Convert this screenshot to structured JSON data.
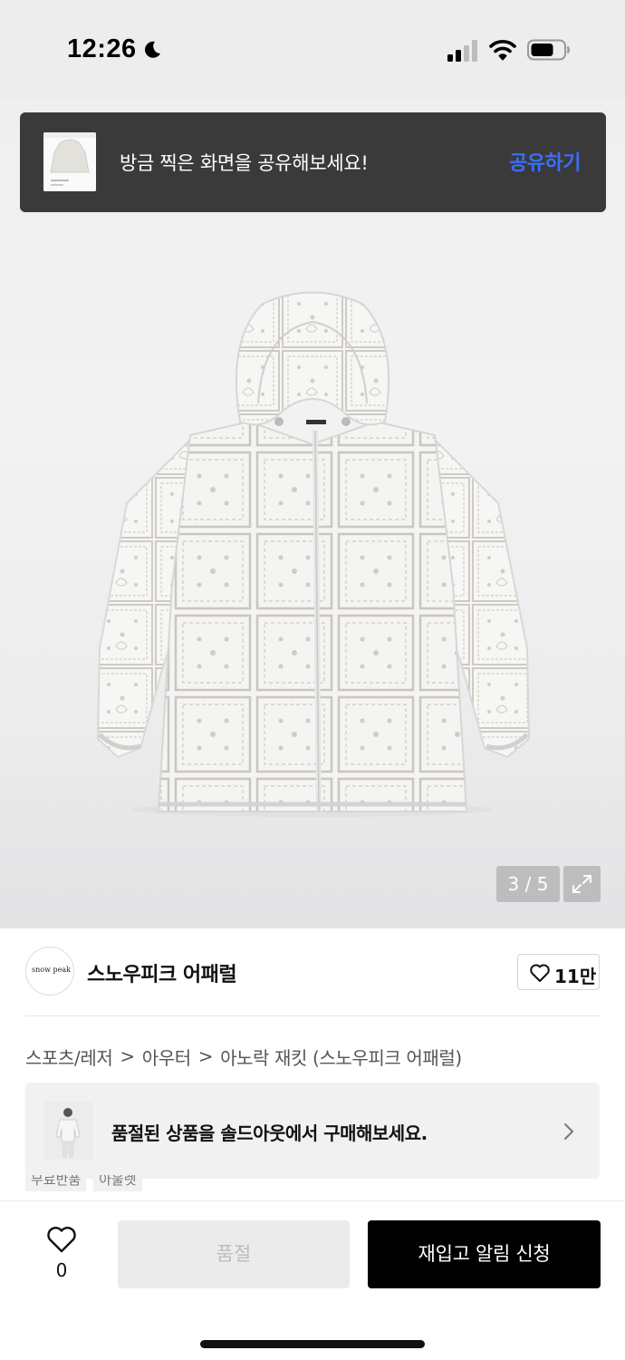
{
  "status_bar": {
    "time": "12:26",
    "icons": [
      "moon-icon",
      "cellular-signal-icon",
      "wifi-icon",
      "battery-icon"
    ]
  },
  "share_toast": {
    "message": "방금 찍은 화면을 공유해보세요!",
    "action_label": "공유하기",
    "action_color": "#3c6ef5"
  },
  "gallery": {
    "current_page": 3,
    "total_pages": 5,
    "page_indicator": "3 / 5",
    "expand_icon": "expand-icon"
  },
  "brand": {
    "logo_text": "snow peak",
    "name": "스노우피크 어패럴",
    "like_count": "11만"
  },
  "breadcrumb": {
    "items": [
      "스포츠/레저",
      "아우터",
      "아노락 재킷 (스노우피크 어패럴)"
    ],
    "separator": ">"
  },
  "soldout_banner": {
    "message": "품절된 상품을 솔드아웃에서 구매해보세요."
  },
  "tags": [
    "무료반품",
    "아울렛"
  ],
  "bottom_bar": {
    "wish_count": "0",
    "soldout_label": "품절",
    "restock_label": "재입고 알림 신청"
  }
}
